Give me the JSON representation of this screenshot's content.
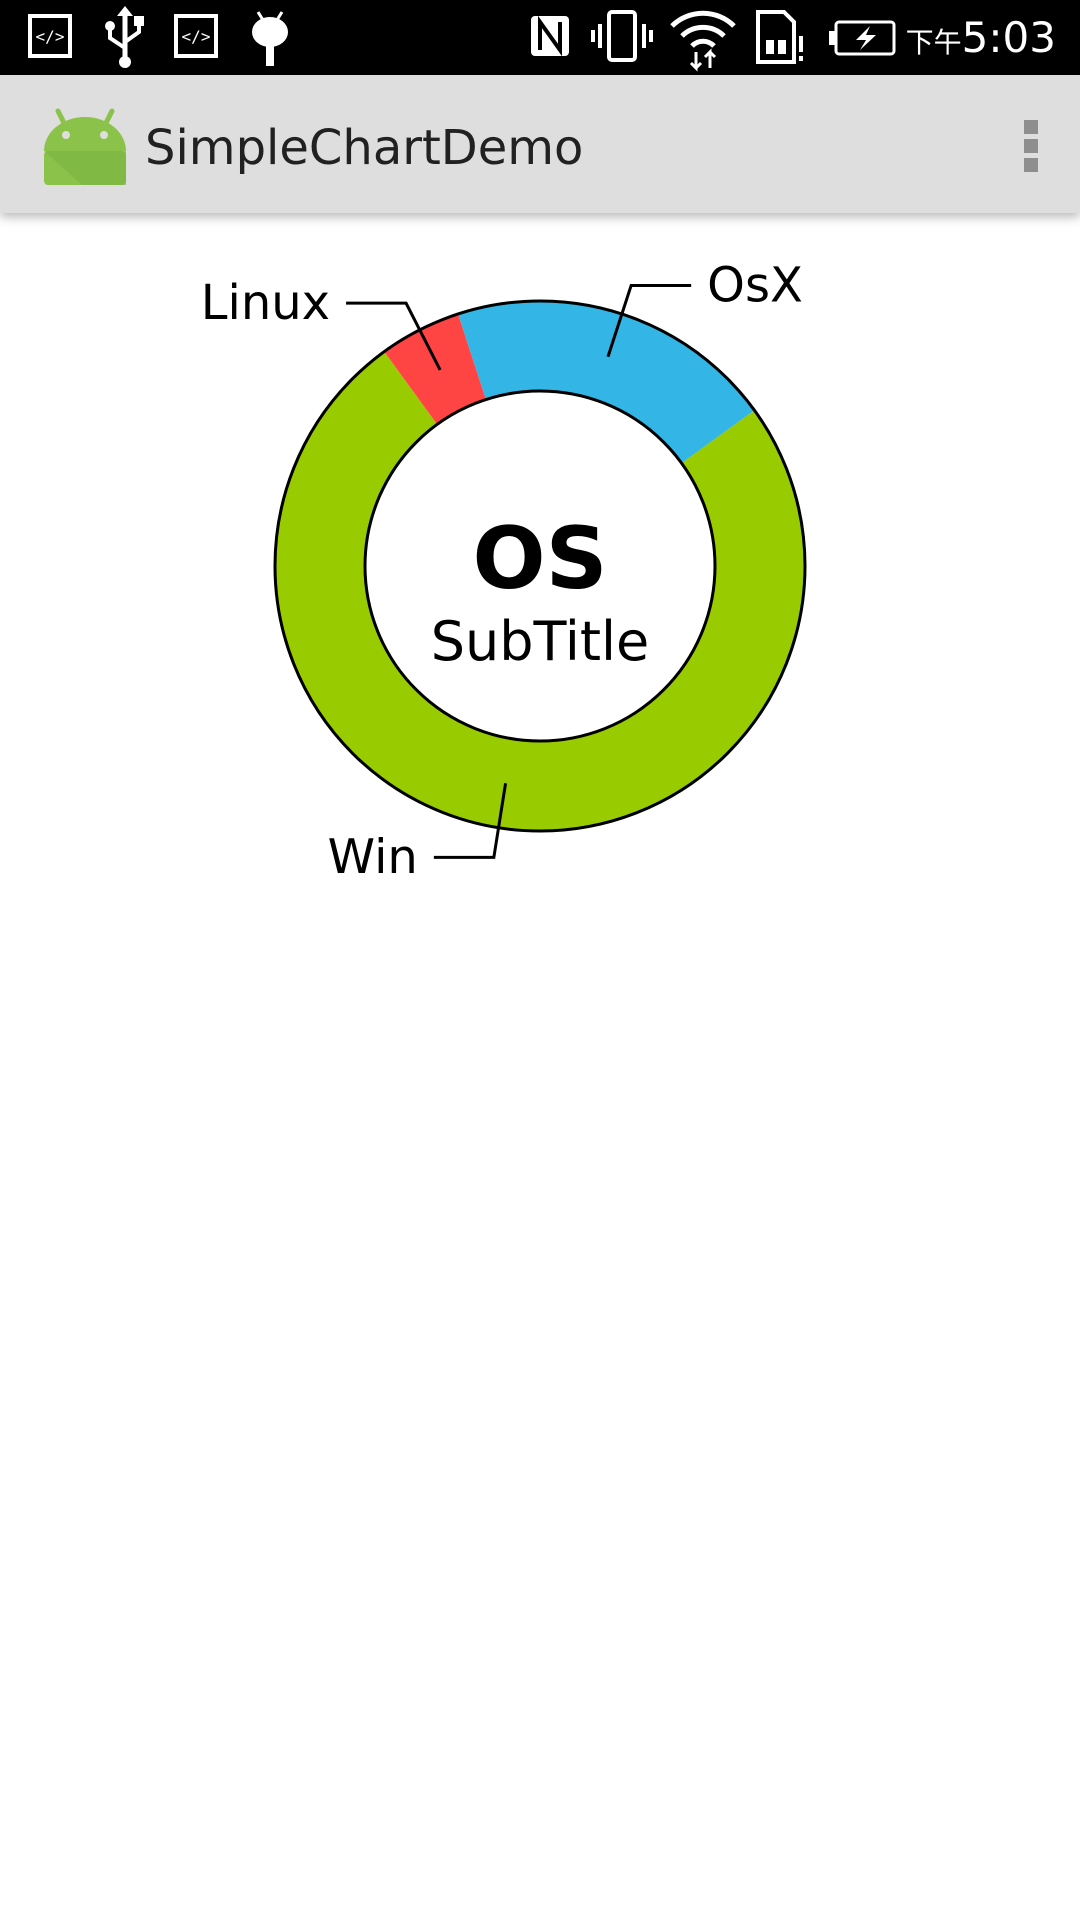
{
  "status_bar": {
    "icons": [
      "code-icon",
      "usb-icon",
      "code-icon",
      "android-debug-icon",
      "nfc-icon",
      "vibrate-icon",
      "wifi-icon",
      "sim-alert-icon",
      "battery-charging-icon"
    ],
    "time_prefix": "下午",
    "time": "5:03"
  },
  "app_bar": {
    "title": "SimpleChartDemo",
    "icon": "android-icon",
    "menu_icon": "overflow-menu-icon"
  },
  "chart_data": {
    "type": "pie",
    "title": "OS",
    "subtitle": "SubTitle",
    "labels": [
      "Win",
      "Linux",
      "OsX"
    ],
    "values": [
      75,
      5,
      20
    ],
    "colors": [
      "#99cc00",
      "#ff4444",
      "#33b5e5"
    ],
    "unit": "%"
  }
}
